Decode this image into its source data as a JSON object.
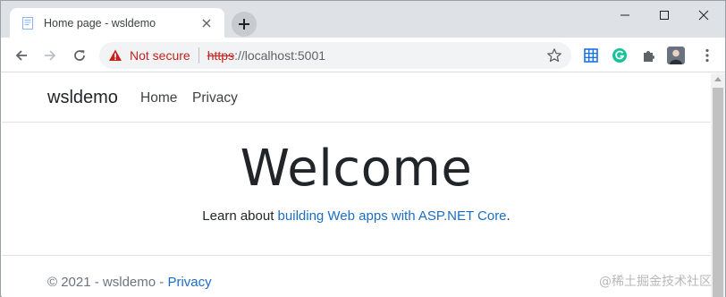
{
  "tab": {
    "title": "Home page - wsldemo",
    "favicon": "document-icon"
  },
  "window_controls": [
    "minimize-icon",
    "maximize-icon",
    "close-icon"
  ],
  "toolbar": {
    "security_label": "Not secure",
    "url_scheme": "https",
    "url_rest": "://localhost:5001"
  },
  "site": {
    "brand": "wsldemo",
    "nav": [
      {
        "label": "Home"
      },
      {
        "label": "Privacy"
      }
    ],
    "heading": "Welcome",
    "learn_prefix": "Learn about ",
    "learn_link": "building Web apps with ASP.NET Core",
    "learn_suffix": ".",
    "footer_prefix": "© 2021 - wsldemo - ",
    "footer_link": "Privacy"
  },
  "watermark": "@稀土掘金技术社区",
  "colors": {
    "link": "#1b6ec2",
    "warning": "#c5221f",
    "grammarly": "#15c39a"
  }
}
